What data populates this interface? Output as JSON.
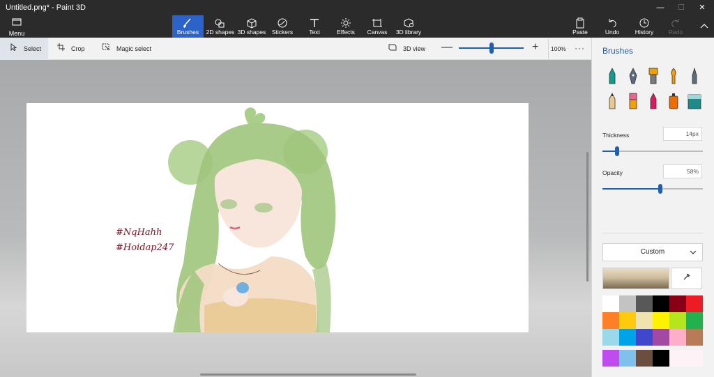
{
  "window": {
    "title": "Untitled.png* - Paint 3D",
    "controls": {
      "minimize": "—",
      "maximize": "☐",
      "close": "✕"
    }
  },
  "ribbon": {
    "menu": {
      "label": "Menu",
      "icon": "menu-folder-icon"
    },
    "tools": [
      {
        "label": "Brushes",
        "icon": "brush-icon",
        "active": true
      },
      {
        "label": "2D shapes",
        "icon": "2d-shapes-icon"
      },
      {
        "label": "3D shapes",
        "icon": "3d-shapes-icon"
      },
      {
        "label": "Stickers",
        "icon": "stickers-icon"
      },
      {
        "label": "Text",
        "icon": "text-icon"
      },
      {
        "label": "Effects",
        "icon": "effects-icon"
      },
      {
        "label": "Canvas",
        "icon": "canvas-icon"
      },
      {
        "label": "3D library",
        "icon": "3d-library-icon"
      }
    ],
    "actions": [
      {
        "label": "Paste",
        "icon": "paste-icon"
      },
      {
        "label": "Undo",
        "icon": "undo-icon"
      },
      {
        "label": "History",
        "icon": "history-icon"
      },
      {
        "label": "Redo",
        "icon": "redo-icon",
        "disabled": true
      }
    ]
  },
  "subtoolbar": {
    "select": "Select",
    "crop": "Crop",
    "magic_select": "Magic select",
    "view3d": "3D view",
    "zoom_minus": "—",
    "zoom_plus": "+",
    "zoom_percent": "100%",
    "more": "···",
    "zoom_level": 0.51
  },
  "canvas": {
    "hashtags": [
      "#NqHahh",
      "#Hoidap247"
    ]
  },
  "panel": {
    "title": "Brushes",
    "brushes": [
      "marker-icon",
      "calligraphy-pen-icon",
      "oil-brush-icon",
      "watercolor-icon",
      "pixel-pen-icon",
      "pencil-icon",
      "eraser-icon",
      "crayon-icon",
      "spray-can-icon",
      "fill-icon"
    ],
    "thickness_label": "Thickness",
    "thickness_value": "14px",
    "thickness_level": 0.14,
    "opacity_label": "Opacity",
    "opacity_value": "58%",
    "opacity_level": 0.58,
    "color_mode": "Custom",
    "current_color": "#d7c7a6",
    "palette": [
      "#ffffff",
      "#c3c3c3",
      "#585858",
      "#000000",
      "#880015",
      "#ed1c24",
      "#ff7f27",
      "#ffc90e",
      "#efe4b0",
      "#fff200",
      "#b5e61d",
      "#22b14c",
      "#99d9ea",
      "#00a2e8",
      "#3f48cc",
      "#a349a4",
      "#ffaec9",
      "#b97a57",
      "#c04cf0",
      "#7fc1ec",
      "#6b4e3d",
      "#000000",
      "#fdf2f6",
      "#fdf2f6"
    ]
  }
}
